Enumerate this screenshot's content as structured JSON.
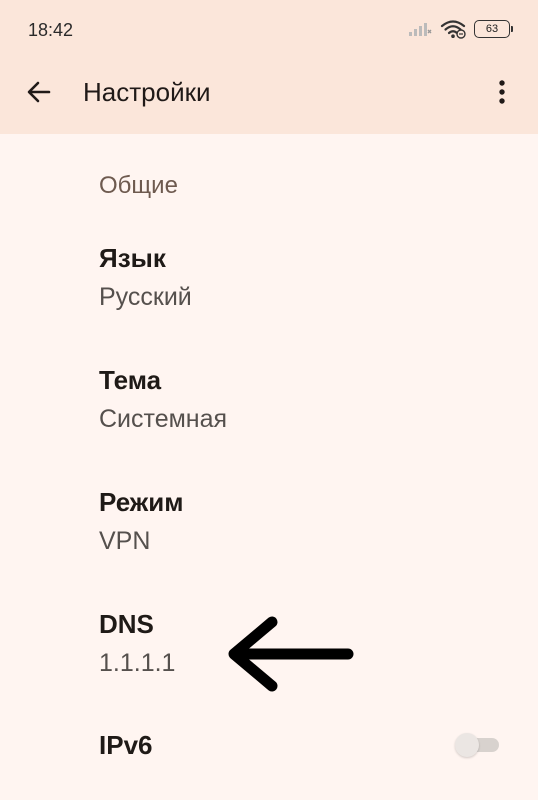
{
  "status_bar": {
    "time": "18:42",
    "battery_level": "63",
    "icons": [
      "signal-icon",
      "wifi-icon",
      "battery-icon"
    ]
  },
  "app_bar": {
    "title": "Настройки",
    "back_icon": "arrow-left-icon",
    "more_icon": "more-vert-icon"
  },
  "section": {
    "title": "Общие"
  },
  "settings": [
    {
      "title": "Язык",
      "value": "Русский"
    },
    {
      "title": "Тема",
      "value": "Системная"
    },
    {
      "title": "Режим",
      "value": "VPN"
    },
    {
      "title": "DNS",
      "value": "1.1.1.1"
    },
    {
      "title": "IPv6",
      "toggle": false
    }
  ],
  "annotation": {
    "icon": "arrow-left-icon",
    "color": "#000000"
  },
  "colors": {
    "app_bar_bg": "#fbe6da",
    "page_bg": "#fff5f1",
    "section_title": "#6e5a4f"
  }
}
